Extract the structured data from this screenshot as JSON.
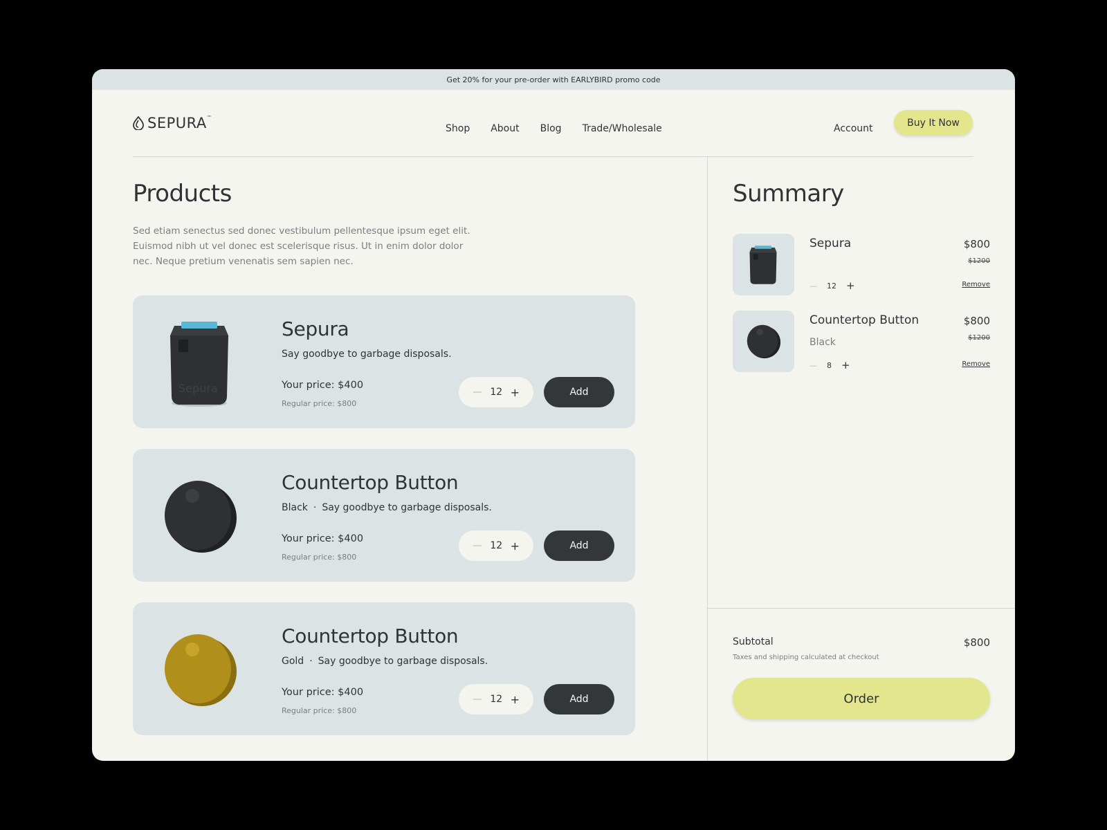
{
  "promo": "Get 20% for your pre-order with EARLYBIRD promo code",
  "brand": {
    "name": "SEPURA",
    "tm": "™"
  },
  "nav": [
    "Shop",
    "About",
    "Blog",
    "Trade/Wholesale"
  ],
  "account": "Account",
  "buy_now": "Buy It Now",
  "products": {
    "title": "Products",
    "description": "Sed etiam senectus sed donec vestibulum pellentesque ipsum eget elit. Euismod nibh ut vel donec est scelerisque risus. Ut in enim dolor dolor nec. Neque pretium venenatis sem sapien nec.",
    "items": [
      {
        "name": "Sepura",
        "variant": "",
        "tagline": "Say goodbye to garbage disposals.",
        "price": "Your price: $400",
        "regular": "Regular price: $800",
        "qty": "12",
        "add": "Add",
        "image": "sepura-device-icon",
        "color": "#2e3033"
      },
      {
        "name": "Countertop Button",
        "variant": "Black",
        "tagline": "Say goodbye to garbage disposals.",
        "price": "Your price: $400",
        "regular": "Regular price: $800",
        "qty": "12",
        "add": "Add",
        "image": "countertop-button-icon",
        "color": "#2e3033"
      },
      {
        "name": "Countertop Button",
        "variant": "Gold",
        "tagline": "Say goodbye to garbage disposals.",
        "price": "Your price: $400",
        "regular": "Regular price: $800",
        "qty": "12",
        "add": "Add",
        "image": "countertop-button-icon",
        "color": "#b0901a"
      }
    ]
  },
  "summary": {
    "title": "Summary",
    "items": [
      {
        "name": "Sepura",
        "variant": "",
        "price": "$800",
        "old_price": "$1200",
        "qty": "12",
        "remove": "Remove"
      },
      {
        "name": "Countertop Button",
        "variant": "Black",
        "price": "$800",
        "old_price": "$1200",
        "qty": "8",
        "remove": "Remove"
      }
    ],
    "subtotal_label": "Subtotal",
    "subtotal_value": "$800",
    "tax_note": "Taxes and shipping calculated at checkout",
    "order": "Order"
  },
  "colors": {
    "accent": "#e3e68c",
    "card": "#dce3e4",
    "dark": "#33373a",
    "background": "#f5f5f0"
  }
}
